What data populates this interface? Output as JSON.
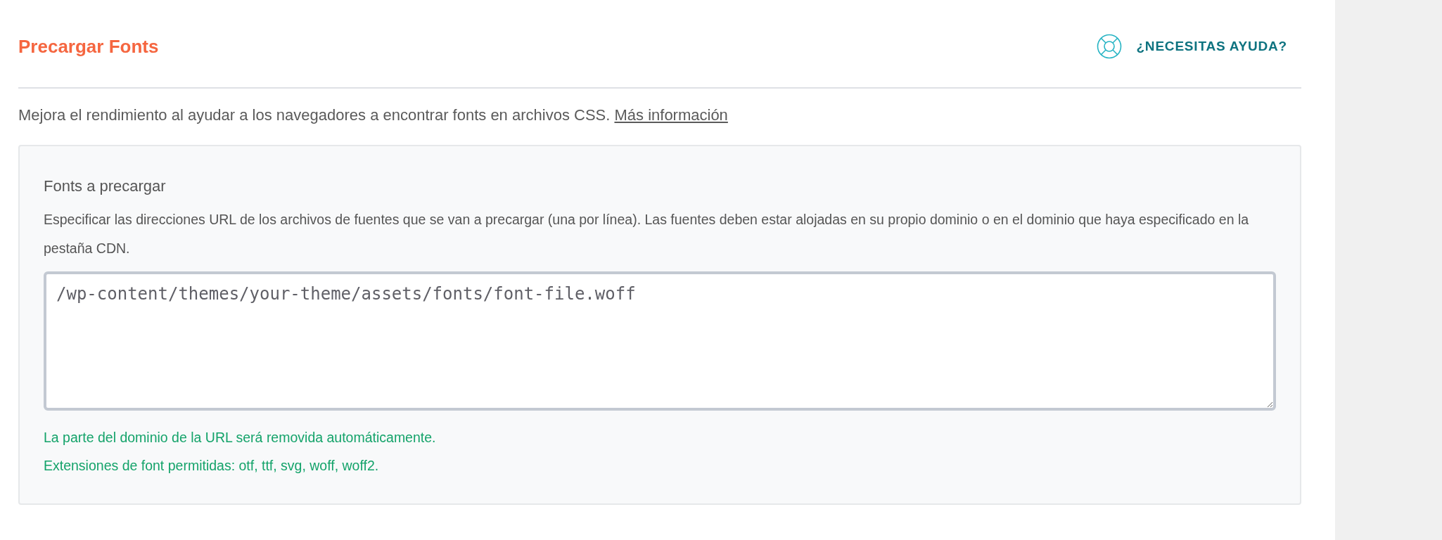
{
  "section": {
    "title": "Precargar Fonts",
    "help_link": "¿NECESITAS AYUDA?",
    "description": "Mejora el rendimiento al ayudar a los navegadores a encontrar fonts en archivos CSS.",
    "more_link": "Más información"
  },
  "field": {
    "label": "Fonts a precargar",
    "description": "Especificar las direcciones URL de los archivos de fuentes que se van a precargar (una por línea). Las fuentes deben estar alojadas en su propio dominio o en el dominio que haya especificado en la pestaña CDN.",
    "placeholder": "/wp-content/themes/your-theme/assets/fonts/font-file.woff",
    "notes": [
      "La parte del dominio de la URL será removida automáticamente.",
      "Extensiones de font permitidas: otf, ttf, svg, woff, woff2."
    ]
  }
}
